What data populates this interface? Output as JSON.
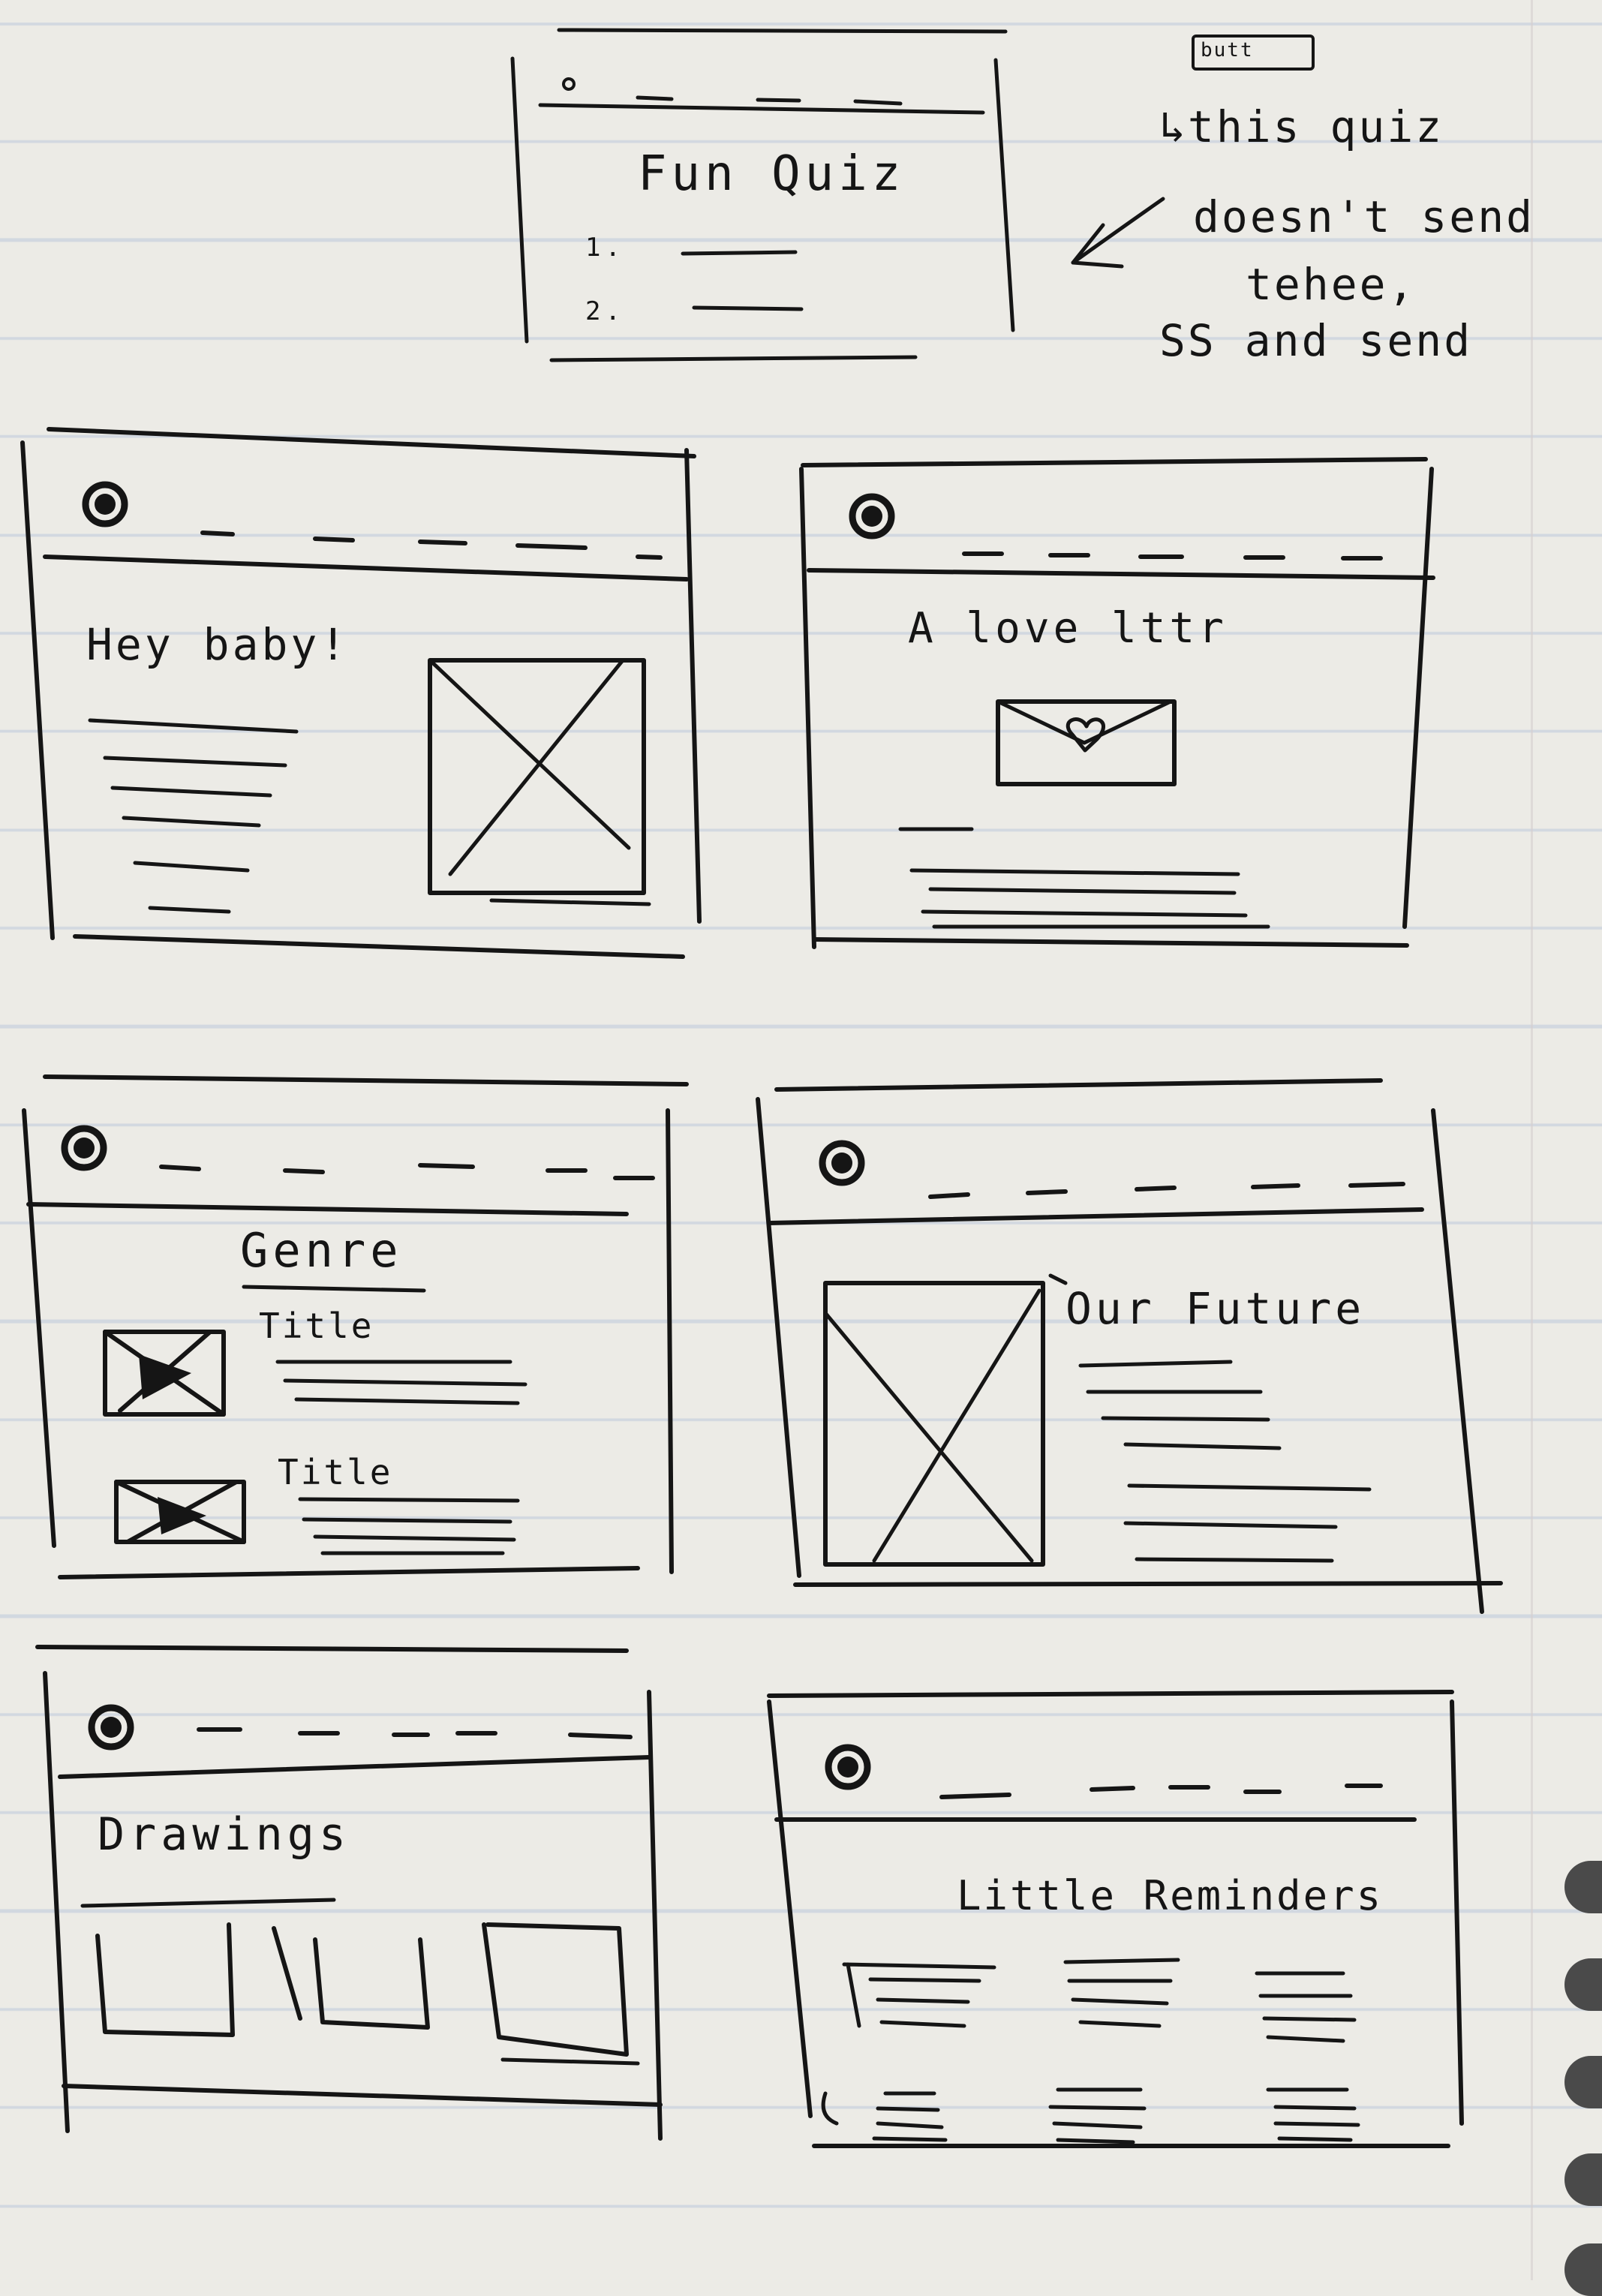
{
  "quiz": {
    "title": "Fun Quiz",
    "items": [
      "1.",
      "2."
    ]
  },
  "annotation": {
    "badge": "butt",
    "lines": [
      "↳this quiz",
      "doesn't send",
      "tehee,",
      "SS and send"
    ]
  },
  "wireframes": {
    "home": {
      "heading": "Hey baby!"
    },
    "letter": {
      "heading": "A love lttr"
    },
    "genre": {
      "heading": "Genre",
      "item_titles": [
        "Title",
        "Title"
      ]
    },
    "future": {
      "heading": "Our Future"
    },
    "drawings": {
      "heading": "Drawings"
    },
    "reminders": {
      "heading": "Little Reminders"
    }
  },
  "ink_color": "#151515",
  "paper_color": "#ecebe6",
  "rule_color": "#c9d2de"
}
